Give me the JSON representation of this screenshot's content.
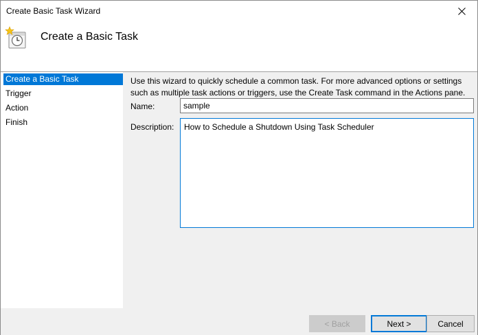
{
  "window": {
    "title": "Create Basic Task Wizard"
  },
  "header": {
    "title": "Create a Basic Task",
    "icon": "task-scheduler-clock-icon"
  },
  "nav": {
    "items": [
      {
        "label": "Create a Basic Task",
        "selected": true
      },
      {
        "label": "Trigger",
        "selected": false
      },
      {
        "label": "Action",
        "selected": false
      },
      {
        "label": "Finish",
        "selected": false
      }
    ]
  },
  "main": {
    "intro": "Use this wizard to quickly schedule a common task.  For more advanced options or settings such as multiple task actions or triggers, use the Create Task command in the Actions pane.",
    "name_label": "Name:",
    "name_value": "sample",
    "description_label": "Description:",
    "description_value": "How to Schedule a Shutdown Using Task Scheduler"
  },
  "footer": {
    "back_label": "< Back",
    "next_label": "Next >",
    "cancel_label": "Cancel"
  },
  "colors": {
    "accent": "#0078d7",
    "panel": "#f0f0f0"
  }
}
